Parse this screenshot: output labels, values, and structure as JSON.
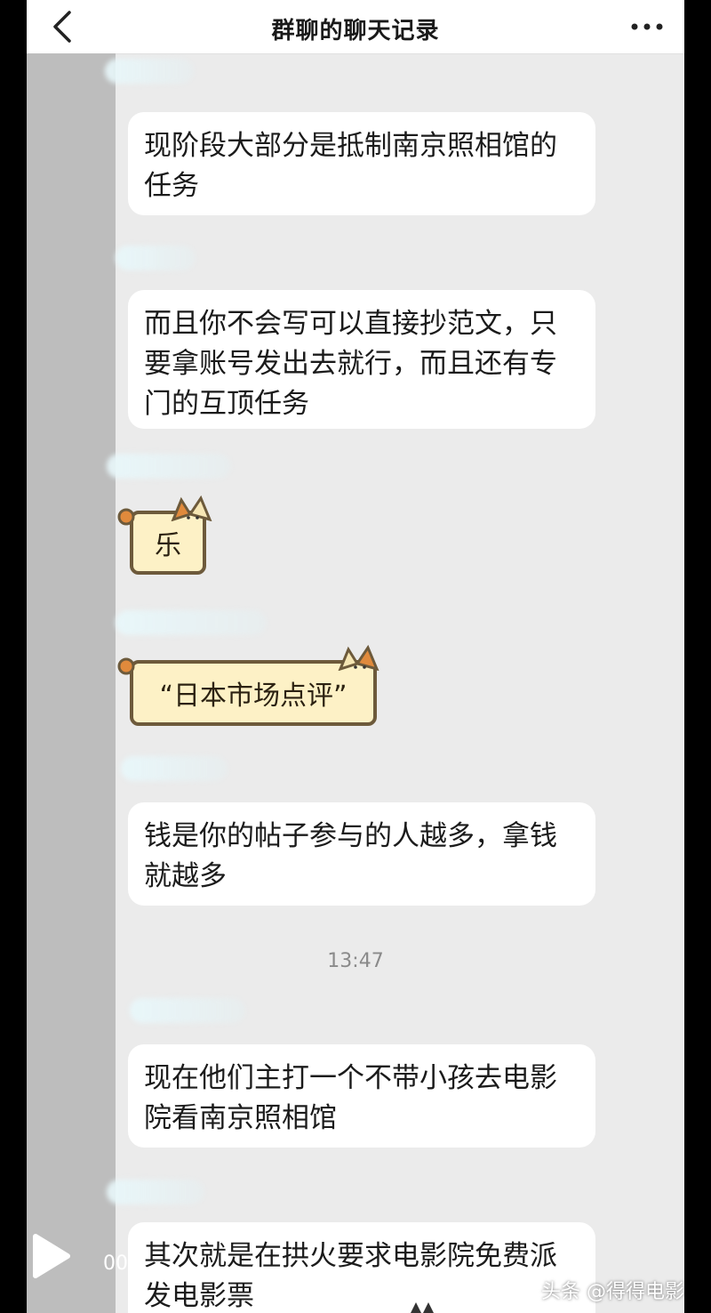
{
  "header": {
    "title": "群聊的聊天记录",
    "back_icon": "chevron-left-icon",
    "more_icon": "more-dots-icon"
  },
  "messages": [
    {
      "text": "现阶段大部分是抵制南京照相馆的任务"
    },
    {
      "text": "而且你不会写可以直接抄范文，只要拿账号发出去就行，而且还有专门的互顶任务"
    },
    {
      "text": "乐"
    },
    {
      "text": "“日本市场点评”"
    },
    {
      "text": "钱是你的帖子参与的人越多，拿钱就越多"
    },
    {
      "text": "现在他们主打一个不带小孩去电影院看南京照相馆"
    },
    {
      "text": "其次就是在拱火要求电影院免费派发电影票"
    }
  ],
  "timestamp": "13:47",
  "player": {
    "time": "00",
    "icon": "play-icon"
  },
  "watermark": "头条 @得得电影",
  "colors": {
    "background": "#ebebeb",
    "bubble": "#ffffff",
    "sticker_fill": "#fdf1c6",
    "sticker_border": "#6d5a3b",
    "cat_ear": "#e08a3c"
  }
}
